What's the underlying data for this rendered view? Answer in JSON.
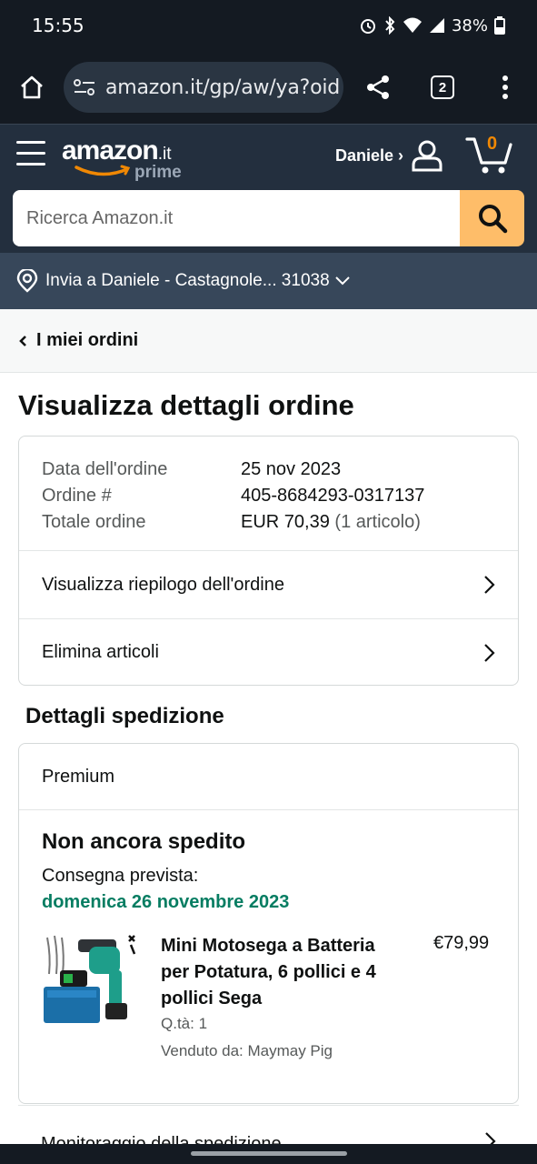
{
  "status_bar": {
    "time": "15:55",
    "battery": "38%"
  },
  "browser": {
    "url": "amazon.it/gp/aw/ya?oid",
    "tab_count": "2"
  },
  "header": {
    "logo_word": "amazon",
    "logo_tld": ".it",
    "logo_prime": "prime",
    "account_label": "Daniele ›",
    "cart_count": "0"
  },
  "search": {
    "placeholder": "Ricerca Amazon.it"
  },
  "deliver": {
    "text": "Invia a Daniele - Castagnole... 31038"
  },
  "back": {
    "label": "I miei ordini"
  },
  "page_title": "Visualizza dettagli ordine",
  "order": {
    "date_label": "Data dell'ordine",
    "date_value": "25 nov 2023",
    "number_label": "Ordine #",
    "number_value": "405-8684293-0317137",
    "total_label": "Totale ordine",
    "total_value": "EUR 70,39",
    "total_items": "(1 articolo)",
    "summary_link": "Visualizza riepilogo dell'ordine",
    "delete_link": "Elimina articoli"
  },
  "shipping": {
    "section_title": "Dettagli spedizione",
    "method": "Premium",
    "status": "Non ancora spedito",
    "eta_label": "Consegna prevista:",
    "eta_date": "domenica 26 novembre 2023",
    "product_title": "Mini Motosega a Batteria per Potatura, 6 pollici e 4 pollici Sega",
    "product_price": "€79,99",
    "product_qty": "Q.tà: 1",
    "product_seller": "Venduto da: Maymay Pig",
    "tracking_link": "Monitoraggio della spedizione"
  },
  "colors": {
    "header_bg": "#232f3e",
    "search_button": "#febd69",
    "deliver_bg": "#37475a",
    "eta_green": "#067d62",
    "cart_orange": "#f08804"
  }
}
